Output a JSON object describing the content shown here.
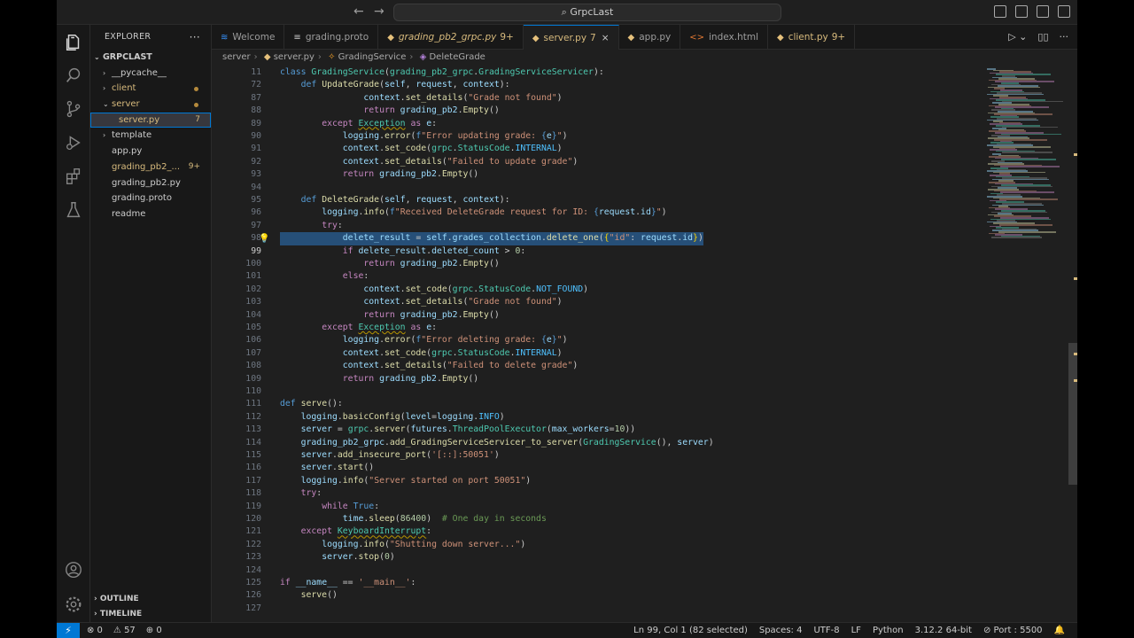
{
  "titlebar": {
    "search": "GrpcLast",
    "back_arrow": "←",
    "forward_arrow": "→"
  },
  "explorer": {
    "header": "EXPLORER",
    "more": "···",
    "root": "GRPCLAST",
    "items": [
      {
        "label": "__pycache__",
        "type": "folder",
        "depth": 1
      },
      {
        "label": "client",
        "type": "folder",
        "depth": 1,
        "modified": true
      },
      {
        "label": "server",
        "type": "folder-open",
        "depth": 1,
        "modified": true
      },
      {
        "label": "server.py",
        "type": "file",
        "depth": 2,
        "badge": "7",
        "selected": true
      },
      {
        "label": "template",
        "type": "folder",
        "depth": 1
      },
      {
        "label": "app.py",
        "type": "file",
        "depth": 1
      },
      {
        "label": "grading_pb2_...",
        "type": "file",
        "depth": 1,
        "badge": "9+"
      },
      {
        "label": "grading_pb2.py",
        "type": "file",
        "depth": 1
      },
      {
        "label": "grading.proto",
        "type": "file",
        "depth": 1
      },
      {
        "label": "readme",
        "type": "file",
        "depth": 1
      }
    ],
    "outline": "OUTLINE",
    "timeline": "TIMELINE"
  },
  "tabs": [
    {
      "label": "Welcome",
      "icon": "≋"
    },
    {
      "label": "grading.proto",
      "icon": "≡"
    },
    {
      "label": "grading_pb2_grpc.py",
      "icon": "◆",
      "badge": "9+",
      "italic": true
    },
    {
      "label": "server.py",
      "icon": "◆",
      "badge": "7",
      "active": true,
      "close": "×"
    },
    {
      "label": "app.py",
      "icon": "◆"
    },
    {
      "label": "index.html",
      "icon": "<>"
    },
    {
      "label": "client.py",
      "icon": "◆",
      "badge": "9+"
    }
  ],
  "breadcrumb": {
    "folder": "server",
    "file": "server.py",
    "class": "GradingService",
    "method": "DeleteGrade"
  },
  "code": {
    "lines": [
      {
        "n": "11",
        "html": "<span class='df'>class</span> <span class='cls'>GradingService</span>(<span class='cls'>grading_pb2_grpc</span>.<span class='cls'>GradingServiceServicer</span>):"
      },
      {
        "n": "72",
        "html": "    <span class='df'>def</span> <span class='fn'>UpdateGrade</span>(<span class='pm'>self</span>, <span class='pm'>request</span>, <span class='pm'>context</span>):"
      },
      {
        "n": "87",
        "html": "                <span class='pm'>context</span>.<span class='fn'>set_details</span>(<span class='st'>\"Grade not found\"</span>)"
      },
      {
        "n": "88",
        "html": "                <span class='kw'>return</span> <span class='pm'>grading_pb2</span>.<span class='fn'>Empty</span>()"
      },
      {
        "n": "89",
        "html": "        <span class='kw'>except</span> <span class='cls wv'>Exception</span> <span class='kw'>as</span> <span class='pm'>e</span>:"
      },
      {
        "n": "90",
        "html": "            <span class='pm'>logging</span>.<span class='fn'>error</span>(<span class='df'>f</span><span class='st'>\"Error updating grade: </span><span class='df'>{</span><span class='pm'>e</span><span class='df'>}</span><span class='st'>\"</span>)"
      },
      {
        "n": "91",
        "html": "            <span class='pm'>context</span>.<span class='fn'>set_code</span>(<span class='cls'>grpc</span>.<span class='cls'>StatusCode</span>.<span class='cn'>INTERNAL</span>)"
      },
      {
        "n": "92",
        "html": "            <span class='pm'>context</span>.<span class='fn'>set_details</span>(<span class='st'>\"Failed to update grade\"</span>)"
      },
      {
        "n": "93",
        "html": "            <span class='kw'>return</span> <span class='pm'>grading_pb2</span>.<span class='fn'>Empty</span>()"
      },
      {
        "n": "94",
        "html": ""
      },
      {
        "n": "95",
        "html": "    <span class='df'>def</span> <span class='fn'>DeleteGrade</span>(<span class='pm'>self</span>, <span class='pm'>request</span>, <span class='pm'>context</span>):"
      },
      {
        "n": "96",
        "html": "        <span class='pm'>logging</span>.<span class='fn'>info</span>(<span class='df'>f</span><span class='st'>\"Received DeleteGrade request for ID: </span><span class='df'>{</span><span class='pm'>request</span>.<span class='pm'>id</span><span class='df'>}</span><span class='st'>\"</span>)"
      },
      {
        "n": "97",
        "html": "        <span class='kw'>try</span>:"
      },
      {
        "n": "98",
        "html": "            <span class='pm'>delete_result</span> = <span class='pm'>self</span>.<span class='pm'>grades_collection</span>.<span class='fn'>delete_one</span>(<span class='br'>{</span><span class='st'>\"id\"</span>: <span class='pm'>request</span>.<span class='pm'>id</span><span class='br'>}</span>)",
        "selected": true,
        "bulb": true
      },
      {
        "n": "99",
        "html": "            <span class='kw'>if</span> <span class='pm'>delete_result</span>.<span class='pm'>deleted_count</span> &gt; <span class='nm'>0</span>:",
        "current": true
      },
      {
        "n": "100",
        "html": "                <span class='kw'>return</span> <span class='pm'>grading_pb2</span>.<span class='fn'>Empty</span>()"
      },
      {
        "n": "101",
        "html": "            <span class='kw'>else</span>:"
      },
      {
        "n": "102",
        "html": "                <span class='pm'>context</span>.<span class='fn'>set_code</span>(<span class='cls'>grpc</span>.<span class='cls'>StatusCode</span>.<span class='cn'>NOT_FOUND</span>)"
      },
      {
        "n": "103",
        "html": "                <span class='pm'>context</span>.<span class='fn'>set_details</span>(<span class='st'>\"Grade not found\"</span>)"
      },
      {
        "n": "104",
        "html": "                <span class='kw'>return</span> <span class='pm'>grading_pb2</span>.<span class='fn'>Empty</span>()"
      },
      {
        "n": "105",
        "html": "        <span class='kw'>except</span> <span class='cls wv'>Exception</span> <span class='kw'>as</span> <span class='pm'>e</span>:"
      },
      {
        "n": "106",
        "html": "            <span class='pm'>logging</span>.<span class='fn'>error</span>(<span class='df'>f</span><span class='st'>\"Error deleting grade: </span><span class='df'>{</span><span class='pm'>e</span><span class='df'>}</span><span class='st'>\"</span>)"
      },
      {
        "n": "107",
        "html": "            <span class='pm'>context</span>.<span class='fn'>set_code</span>(<span class='cls'>grpc</span>.<span class='cls'>StatusCode</span>.<span class='cn'>INTERNAL</span>)"
      },
      {
        "n": "108",
        "html": "            <span class='pm'>context</span>.<span class='fn'>set_details</span>(<span class='st'>\"Failed to delete grade\"</span>)"
      },
      {
        "n": "109",
        "html": "            <span class='kw'>return</span> <span class='pm'>grading_pb2</span>.<span class='fn'>Empty</span>()"
      },
      {
        "n": "110",
        "html": ""
      },
      {
        "n": "111",
        "html": "<span class='df'>def</span> <span class='fn'>serve</span>():"
      },
      {
        "n": "112",
        "html": "    <span class='pm'>logging</span>.<span class='fn'>basicConfig</span>(<span class='pm'>level</span>=<span class='pm'>logging</span>.<span class='cn'>INFO</span>)"
      },
      {
        "n": "113",
        "html": "    <span class='pm'>server</span> = <span class='cls'>grpc</span>.<span class='fn'>server</span>(<span class='pm'>futures</span>.<span class='cls'>ThreadPoolExecutor</span>(<span class='pm'>max_workers</span>=<span class='nm'>10</span>))"
      },
      {
        "n": "114",
        "html": "    <span class='pm'>grading_pb2_grpc</span>.<span class='fn'>add_GradingServiceServicer_to_server</span>(<span class='cls'>GradingService</span>(), <span class='pm'>server</span>)"
      },
      {
        "n": "115",
        "html": "    <span class='pm'>server</span>.<span class='fn'>add_insecure_port</span>(<span class='st'>'[::]:50051'</span>)"
      },
      {
        "n": "116",
        "html": "    <span class='pm'>server</span>.<span class='fn'>start</span>()"
      },
      {
        "n": "117",
        "html": "    <span class='pm'>logging</span>.<span class='fn'>info</span>(<span class='st'>\"Server started on port 50051\"</span>)"
      },
      {
        "n": "118",
        "html": "    <span class='kw'>try</span>:"
      },
      {
        "n": "119",
        "html": "        <span class='kw'>while</span> <span class='df'>True</span>:"
      },
      {
        "n": "120",
        "html": "            <span class='pm'>time</span>.<span class='fn'>sleep</span>(<span class='nm'>86400</span>)  <span class='cm'># One day in seconds</span>"
      },
      {
        "n": "121",
        "html": "    <span class='kw'>except</span> <span class='cls wv'>KeyboardInterrupt</span>:"
      },
      {
        "n": "122",
        "html": "        <span class='pm'>logging</span>.<span class='fn'>info</span>(<span class='st'>\"Shutting down server...\"</span>)"
      },
      {
        "n": "123",
        "html": "        <span class='pm'>server</span>.<span class='fn'>stop</span>(<span class='nm'>0</span>)"
      },
      {
        "n": "124",
        "html": ""
      },
      {
        "n": "125",
        "html": "<span class='kw'>if</span> <span class='pm'>__name__</span> == <span class='st'>'__main__'</span>:"
      },
      {
        "n": "126",
        "html": "    <span class='fn'>serve</span>()"
      },
      {
        "n": "127",
        "html": ""
      }
    ]
  },
  "statusbar": {
    "remote": "⚡",
    "errors": "⊗ 0",
    "warnings": "⚠ 57",
    "ports_icon": "⊕ 0",
    "position": "Ln 99, Col 1 (82 selected)",
    "spaces": "Spaces: 4",
    "encoding": "UTF-8",
    "eol": "LF",
    "language": "Python",
    "interpreter": "3.12.2 64-bit",
    "port": "⊘ Port : 5500",
    "bell": "🔔"
  },
  "colors": {
    "accent": "#0078d4",
    "selection": "#264f78",
    "modified": "#d7ba7d"
  }
}
